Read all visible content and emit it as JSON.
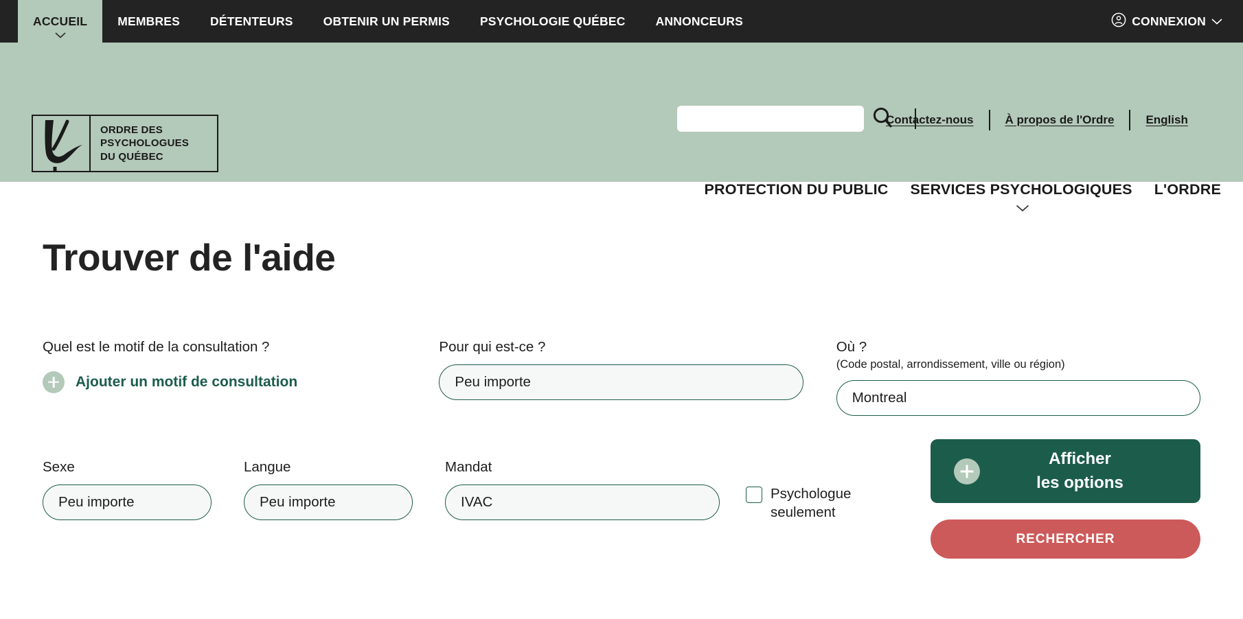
{
  "topbar": {
    "nav": [
      {
        "label": "ACCUEIL",
        "active": true,
        "icon": "chevron-down-icon"
      },
      {
        "label": "MEMBRES",
        "active": false
      },
      {
        "label": "DÉTENTEURS",
        "active": false
      },
      {
        "label": "OBTENIR UN PERMIS",
        "active": false
      },
      {
        "label": "PSYCHOLOGIE QUÉBEC",
        "active": false
      },
      {
        "label": "ANNONCEURS",
        "active": false
      }
    ],
    "login": {
      "label": "CONNEXION",
      "icon": "user-circle-icon",
      "caret": "chevron-down-icon"
    }
  },
  "header": {
    "logo": {
      "line1": "ORDRE DES",
      "line2": "PSYCHOLOGUES",
      "line3": "DU QUÉBEC",
      "mark": "opq-swoosh-mark"
    },
    "search": {
      "value": "",
      "placeholder": "",
      "icon": "search-icon"
    },
    "util_links": [
      {
        "label": "Contactez-nous"
      },
      {
        "label": "À propos de l'Ordre"
      },
      {
        "label": "English"
      }
    ],
    "mainnav": [
      {
        "label": "PROTECTION DU PUBLIC",
        "caret": false
      },
      {
        "label": "SERVICES PSYCHOLOGIQUES",
        "caret": true
      },
      {
        "label": "L'ORDRE",
        "caret": false
      }
    ]
  },
  "page": {
    "title": "Trouver de l'aide"
  },
  "form": {
    "motif": {
      "label": "Quel est le motif de la consultation ?",
      "add_label": "Ajouter un motif de consultation",
      "add_icon": "plus-circle-icon"
    },
    "pour_qui": {
      "label": "Pour qui est-ce ?",
      "value": "Peu importe"
    },
    "ou": {
      "label": "Où ?",
      "sublabel": "(Code postal, arrondissement, ville ou région)",
      "value": "Montreal",
      "placeholder": "Montreal"
    },
    "sexe": {
      "label": "Sexe",
      "value": "Peu importe"
    },
    "langue": {
      "label": "Langue",
      "value": "Peu importe"
    },
    "mandat": {
      "label": "Mandat",
      "value": "IVAC"
    },
    "psychologue_only": {
      "label": "Psychologue seulement",
      "checked": false
    },
    "buttons": {
      "options_label": "Afficher\nles options",
      "options_line1": "Afficher",
      "options_line2": "les options",
      "options_icon": "plus-circle-icon",
      "search_label": "RECHERCHER"
    }
  },
  "colors": {
    "sage": "#b3c9b9",
    "dark_bar": "#232323",
    "green_accent": "#1c5c4b",
    "red_accent": "#cd5a5a",
    "field_bg": "#f6f8f8"
  }
}
